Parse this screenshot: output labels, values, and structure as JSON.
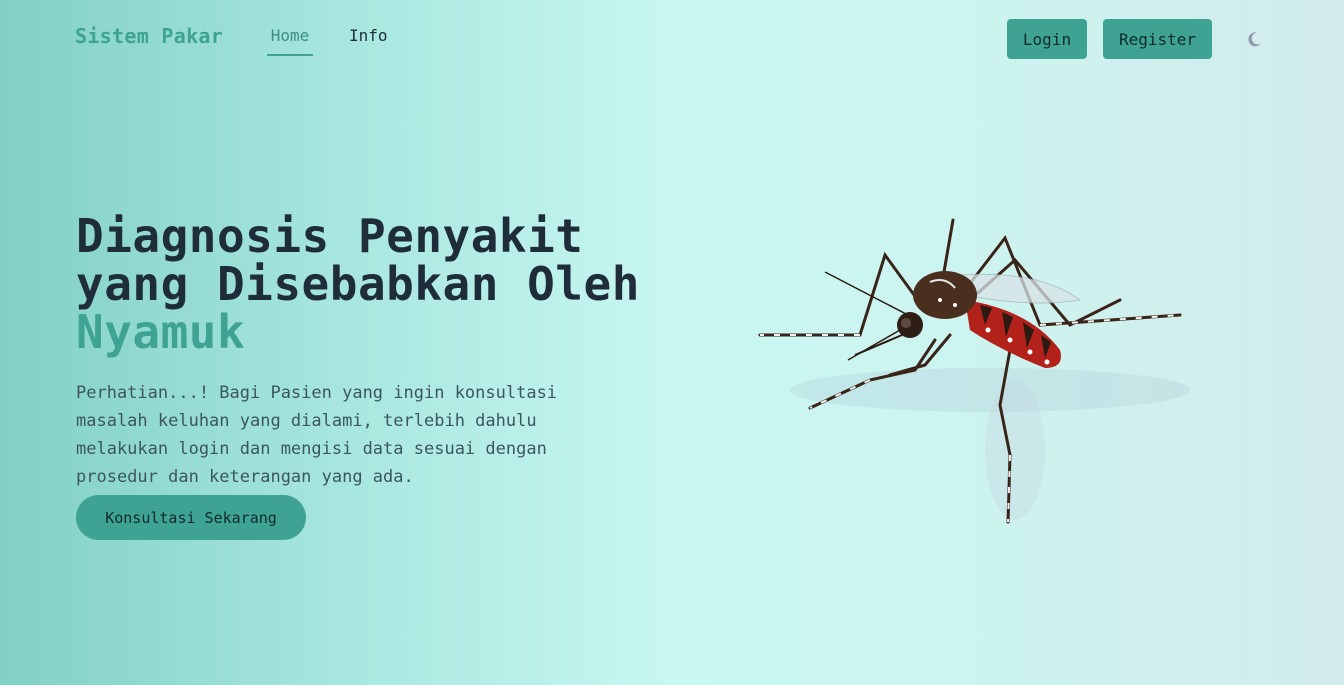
{
  "navbar": {
    "brand": "Sistem Pakar",
    "links": [
      {
        "label": "Home",
        "active": true
      },
      {
        "label": "Info",
        "active": false
      }
    ],
    "login_label": "Login",
    "register_label": "Register",
    "theme_toggle_icon": "moon-icon"
  },
  "hero": {
    "title_line1": "Diagnosis Penyakit",
    "title_line2": "yang Disebabkan Oleh",
    "title_accent": "Nyamuk",
    "description": "Perhatian...! Bagi Pasien yang ingin konsultasi masalah keluhan yang dialami, terlebih dahulu melakukan login dan mengisi data sesuai dengan prosedur dan keterangan yang ada.",
    "cta_label": "Konsultasi Sekarang",
    "image": "mosquito-illustration"
  },
  "colors": {
    "accent": "#3fa394",
    "text_dark": "#1f2d3a",
    "text_muted": "#3c5660"
  }
}
